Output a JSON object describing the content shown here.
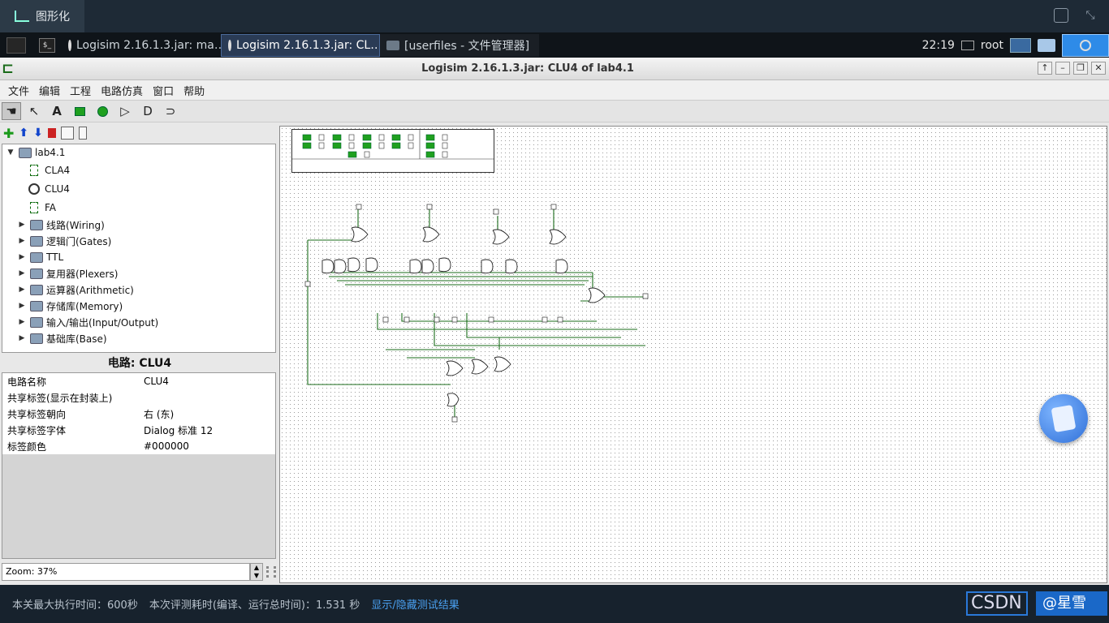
{
  "top": {
    "tab_label": "图形化"
  },
  "taskbar": {
    "items": [
      {
        "label": "Logisim 2.16.1.3.jar: ma…"
      },
      {
        "label": "Logisim 2.16.1.3.jar: CL…"
      },
      {
        "label": "[userfiles - 文件管理器]"
      }
    ],
    "clock": "22:19",
    "user": "root"
  },
  "window": {
    "title": "Logisim 2.16.1.3.jar: CLU4 of lab4.1",
    "menu": [
      "文件",
      "编辑",
      "工程",
      "电路仿真",
      "窗口",
      "帮助"
    ]
  },
  "tree": {
    "root": "lab4.1",
    "circuits": [
      "CLA4",
      "CLU4",
      "FA"
    ],
    "libraries": [
      "线路(Wiring)",
      "逻辑门(Gates)",
      "TTL",
      "复用器(Plexers)",
      "运算器(Arithmetic)",
      "存储库(Memory)",
      "输入/输出(Input/Output)",
      "基础库(Base)"
    ]
  },
  "attributes": {
    "title": "电路: CLU4",
    "rows": [
      {
        "key": "电路名称",
        "value": "CLU4"
      },
      {
        "key": "共享标签(显示在封装上)",
        "value": ""
      },
      {
        "key": "共享标签朝向",
        "value": "右 (东)"
      },
      {
        "key": "共享标签字体",
        "value": "Dialog 标准 12"
      },
      {
        "key": "标签颜色",
        "value": "#000000"
      }
    ]
  },
  "zoom": {
    "label": "Zoom:  37%"
  },
  "status": {
    "max_time": "本关最大执行时间：600秒",
    "elapsed": "本次评测耗时(编译、运行总时间)：1.531 秒",
    "toggle_link": "显示/隐藏测试结果"
  },
  "watermark": {
    "left": "CSDN",
    "right": "@星雪"
  }
}
